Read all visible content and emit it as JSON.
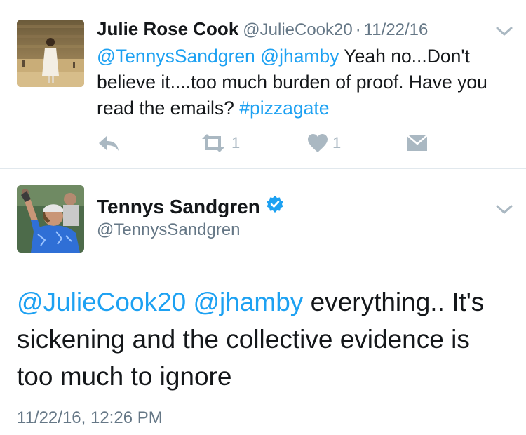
{
  "tweet1": {
    "name": "Julie Rose Cook",
    "handle": "@JulieCook20",
    "separator": "·",
    "date": "11/22/16",
    "mentions": [
      "@TennysSandgren",
      "@jhamby"
    ],
    "text_part": "Yeah no...Don't believe it....too much burden of proof. Have you read the emails?",
    "hashtag": "#pizzagate",
    "actions": {
      "reply_icon": "reply-icon",
      "retweet_icon": "retweet-icon",
      "retweet_count": "1",
      "like_icon": "heart-icon",
      "like_count": "1",
      "dm_icon": "envelope-icon"
    }
  },
  "tweet2": {
    "name": "Tennys Sandgren",
    "verified_icon": "verified-badge-icon",
    "handle": "@TennysSandgren",
    "mentions": [
      "@JulieCook20",
      "@jhamby"
    ],
    "text_part": "everything.. It's sickening and the collective evidence is too much to ignore",
    "timestamp": "11/22/16, 12:26 PM"
  },
  "colors": {
    "link": "#1da1f2",
    "secondary_text": "#657786",
    "action_icon": "#aab8c2",
    "divider": "#e1e8ed"
  }
}
